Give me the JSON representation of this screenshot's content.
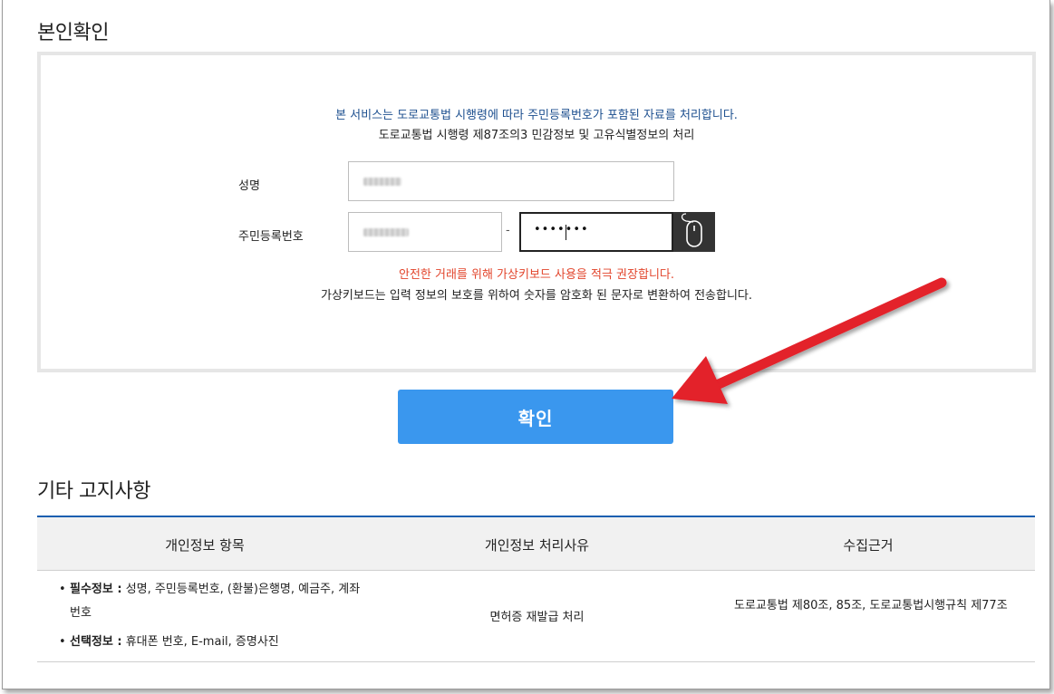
{
  "section1": {
    "title": "본인확인"
  },
  "verify": {
    "notice_line1": "본 서비스는 도로교통법 시행령에 따라 주민등록번호가 포함된 자료를 처리합니다.",
    "notice_line2": "도로교통법 시행령 제87조의3 민감정보 및 고유식별정보의 처리",
    "name_label": "성명",
    "rrn_label": "주민등록번호",
    "rrn_separator": "-",
    "rrn_back_value": "•••••••",
    "keyboard_warning": "안전한 거래를 위해 가상키보드 사용을 적극 권장합니다.",
    "keyboard_info": "가상키보드는 입력 정보의 보호를 위하여 숫자를 암호화 된 문자로 변환하여 전송합니다."
  },
  "confirm_button": {
    "label": "확인"
  },
  "section2": {
    "title": "기타 고지사항"
  },
  "notice_table": {
    "headers": [
      "개인정보 항목",
      "개인정보 처리사유",
      "수집근거"
    ],
    "row": {
      "required_label": "필수정보 :",
      "required_value": " 성명, 주민등록번호, (환불)은행명, 예금주, 계좌번호",
      "optional_label": "선택정보 :",
      "optional_value": " 휴대폰 번호, E-mail, 증명사진",
      "reason": "면허증 재발급 처리",
      "basis": "도로교통법 제80조, 85조, 도로교통법시행규칙 제77조"
    }
  },
  "annotation": {
    "arrow_color": "#e3202a",
    "icon": "mouse-icon"
  },
  "colors": {
    "accent": "#3a97ee",
    "notice_blue": "#1c4f8f",
    "warning_red": "#e2452c",
    "table_border": "#1a5fb0"
  }
}
